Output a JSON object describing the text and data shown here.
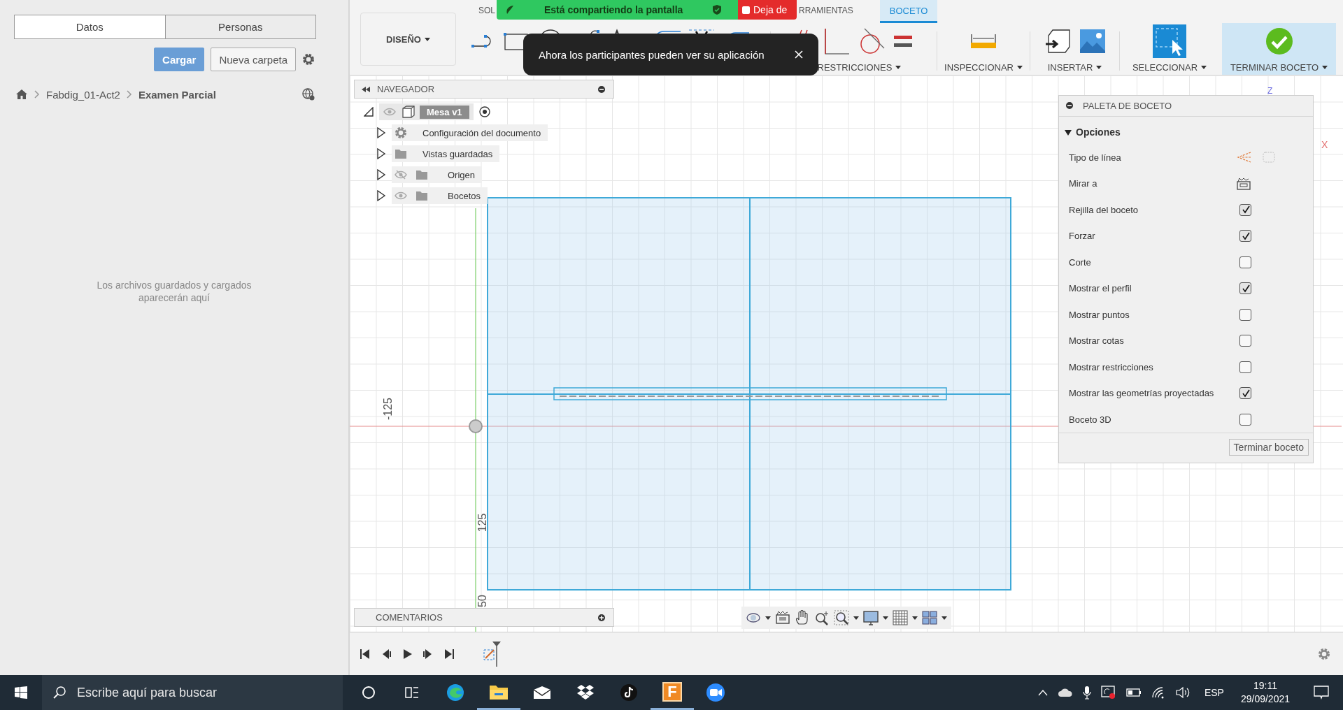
{
  "data_panel": {
    "tabs": [
      {
        "label": "Datos",
        "selected": true
      },
      {
        "label": "Personas",
        "selected": false
      }
    ],
    "buttons": [
      {
        "label": "Cargar",
        "kind": "primary"
      },
      {
        "label": "Nueva carpeta",
        "kind": "secondary"
      }
    ],
    "breadcrumb": [
      "Fabdig_01-Act2",
      "Examen Parcial"
    ],
    "empty_message": "Los archivos guardados y cargados aparecerán aquí"
  },
  "toolbar": {
    "workspace": "DISEÑO",
    "tabs": [
      {
        "label": "SOL",
        "selected": false
      },
      {
        "label": "RRAMIENTAS",
        "selected": false
      },
      {
        "label": "BOCETO",
        "selected": true
      }
    ],
    "groups": [
      {
        "kind": "create"
      },
      {
        "kind": "modify"
      },
      {
        "kind": "constraints",
        "label": "RESTRICCIONES"
      },
      {
        "kind": "inspect",
        "label": "INSPECCIONAR"
      },
      {
        "kind": "insert",
        "label": "INSERTAR"
      },
      {
        "kind": "select",
        "label": "SELECCIONAR"
      },
      {
        "kind": "finish",
        "label": "TERMINAR BOCETO"
      }
    ]
  },
  "share_bar": {
    "status": "Está compartiendo la pantalla",
    "stop": "Deja de"
  },
  "toast": {
    "message": "Ahora los participantes pueden ver su aplicación"
  },
  "browser": {
    "title": "NAVEGADOR",
    "root": {
      "label": "Mesa v1",
      "expanded": true,
      "children": [
        {
          "label": "Configuración del documento",
          "kind": "settings",
          "expanded": false
        },
        {
          "label": "Vistas guardadas",
          "kind": "folder",
          "expanded": false
        },
        {
          "label": "Origen",
          "kind": "folder",
          "visible": false,
          "expanded": false
        },
        {
          "label": "Bocetos",
          "kind": "folder",
          "visible": true,
          "expanded": false
        }
      ]
    }
  },
  "canvas": {
    "axis_labels": [
      "-125",
      "125",
      "50"
    ],
    "triad": [
      "Z",
      "X"
    ]
  },
  "palette": {
    "title": "PALETA DE BOCETO",
    "section": "Opciones",
    "expanded": true,
    "tools": [
      {
        "label": "Tipo de línea",
        "kind": "linetype"
      },
      {
        "label": "Mirar a",
        "kind": "look"
      }
    ],
    "options": [
      {
        "label": "Rejilla del boceto",
        "checked": true
      },
      {
        "label": "Forzar",
        "checked": true
      },
      {
        "label": "Corte",
        "checked": false
      },
      {
        "label": "Mostrar el perfil",
        "checked": true
      },
      {
        "label": "Mostrar puntos",
        "checked": false
      },
      {
        "label": "Mostrar cotas",
        "checked": false
      },
      {
        "label": "Mostrar restricciones",
        "checked": false
      },
      {
        "label": "Mostrar las geometrías proyectadas",
        "checked": true
      },
      {
        "label": "Boceto 3D",
        "checked": false
      }
    ],
    "button": "Terminar boceto"
  },
  "comments": {
    "title": "COMENTARIOS"
  },
  "taskbar": {
    "search_placeholder": "Escribe aquí para buscar",
    "app_letter": "F",
    "language": "ESP",
    "time": "19:11",
    "date": "29/09/2021"
  }
}
